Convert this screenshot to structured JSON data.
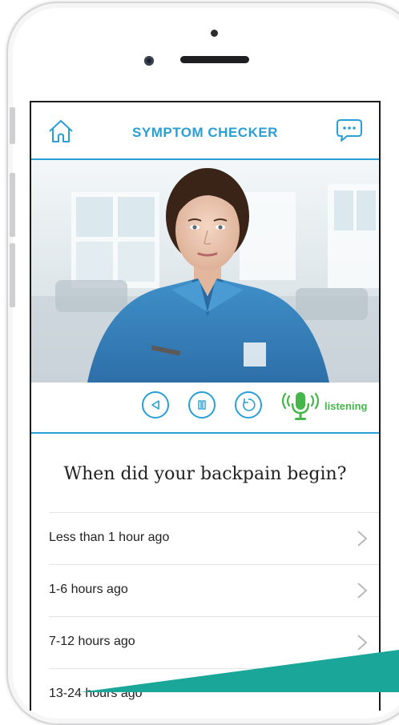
{
  "header": {
    "title": "SYMPTOM CHECKER"
  },
  "controls": {
    "status_label": "listening"
  },
  "question": {
    "text": "When did your backpain begin?"
  },
  "options": [
    {
      "label": "Less than 1 hour ago"
    },
    {
      "label": "1-6 hours ago"
    },
    {
      "label": "7-12 hours ago"
    },
    {
      "label": "13-24 hours ago"
    }
  ],
  "colors": {
    "accent": "#2a9fd6",
    "listening": "#46b64a",
    "teal_banner": "#1aa79a"
  },
  "icons": [
    "home-icon",
    "chat-icon",
    "back-icon",
    "pause-icon",
    "replay-icon",
    "microphone-icon",
    "chevron-right-icon"
  ]
}
